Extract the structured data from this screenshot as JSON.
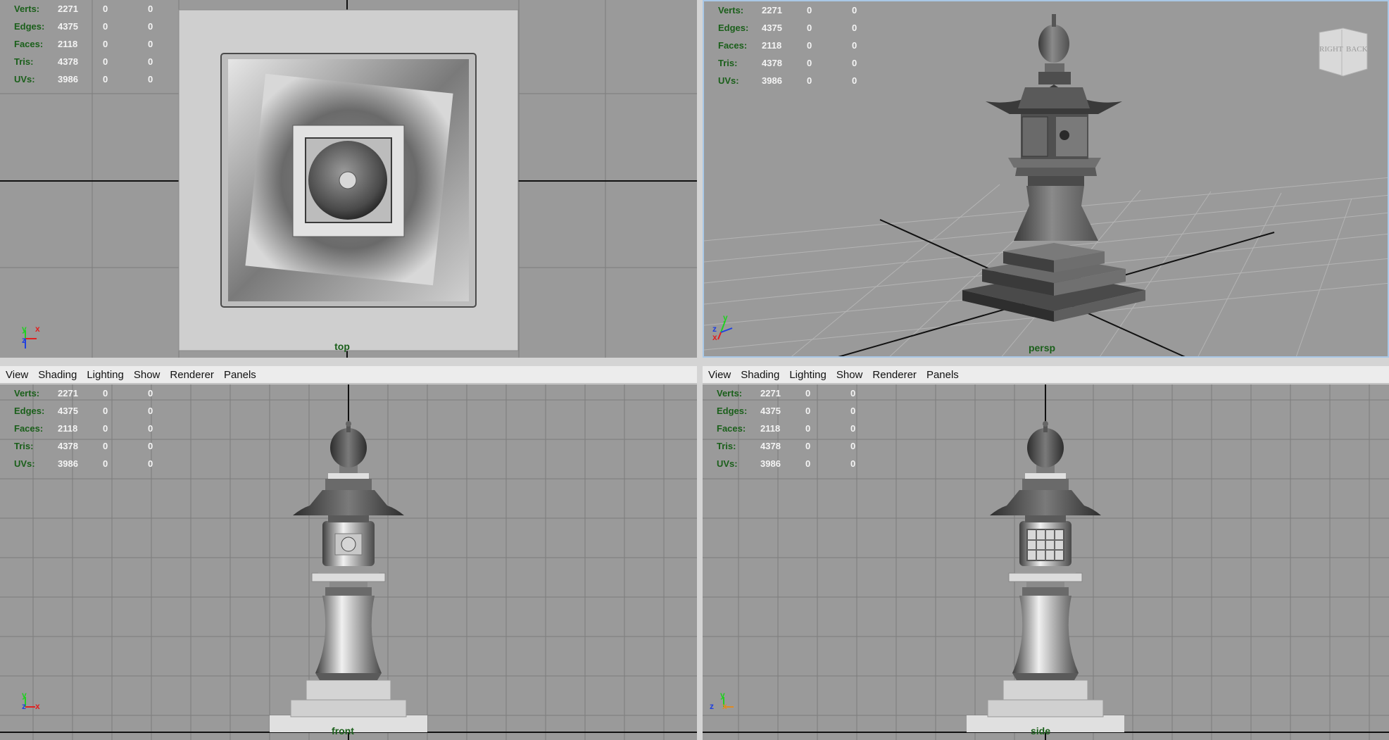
{
  "stats": {
    "rows": [
      {
        "label": "Verts:",
        "v1": "2271",
        "v2": "0",
        "v3": "0"
      },
      {
        "label": "Edges:",
        "v1": "4375",
        "v2": "0",
        "v3": "0"
      },
      {
        "label": "Faces:",
        "v1": "2118",
        "v2": "0",
        "v3": "0"
      },
      {
        "label": "Tris:",
        "v1": "4378",
        "v2": "0",
        "v3": "0"
      },
      {
        "label": "UVs:",
        "v1": "3986",
        "v2": "0",
        "v3": "0"
      }
    ]
  },
  "menu": {
    "view": "View",
    "shading": "Shading",
    "lighting": "Lighting",
    "show": "Show",
    "renderer": "Renderer",
    "panels": "Panels"
  },
  "panels": {
    "top": {
      "camera": "top"
    },
    "persp": {
      "camera": "persp"
    },
    "front": {
      "camera": "front"
    },
    "side": {
      "camera": "side"
    }
  },
  "viewcube": {
    "right": "RIGHT",
    "back": "BACK"
  },
  "axes": {
    "top": {
      "up": "y",
      "right": "x",
      "depth": "z"
    },
    "persp": {
      "up": "y",
      "right": "x",
      "depth": "z"
    },
    "front": {
      "up": "y",
      "left": "z",
      "right": "x"
    },
    "side": {
      "up": "y",
      "left": "z",
      "right": "x"
    }
  },
  "colors": {
    "viewport_bg": "#9a9a9a",
    "hud_label": "#1a5f1a",
    "axis_x": "#e02020",
    "axis_y": "#20d020",
    "axis_z": "#2040e0",
    "active_border": "#a9c8e6"
  }
}
